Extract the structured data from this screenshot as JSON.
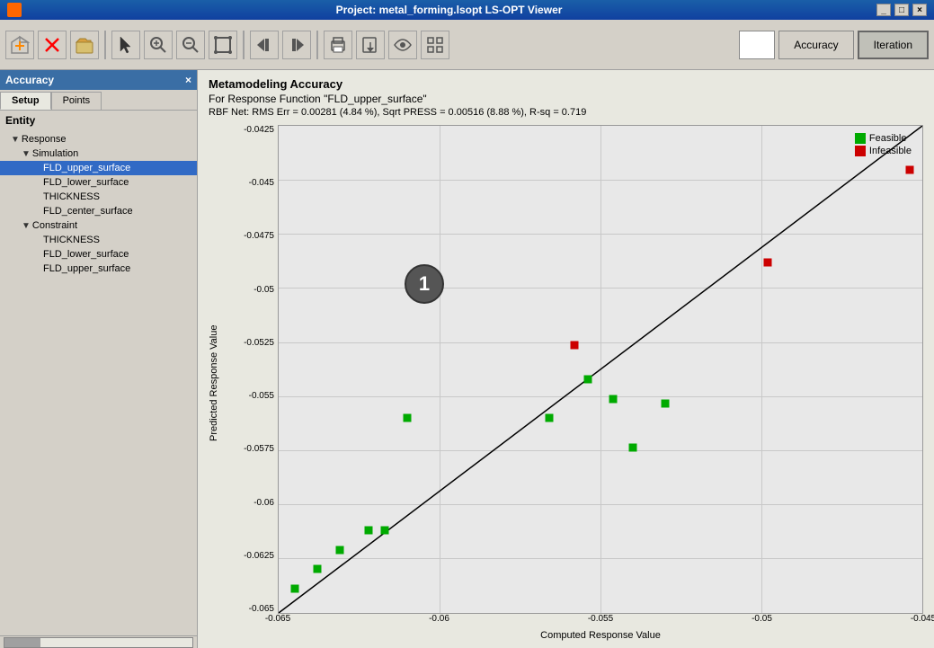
{
  "titlebar": {
    "icon": "app-icon",
    "title": "Project: metal_forming.lsopt    LS-OPT Viewer",
    "minimize_label": "_",
    "maximize_label": "□",
    "close_label": "×"
  },
  "toolbar": {
    "buttons": [
      {
        "name": "new-button",
        "icon": "⊕",
        "label": "New"
      },
      {
        "name": "open-button",
        "icon": "✗",
        "label": "Delete"
      },
      {
        "name": "save-button",
        "icon": "📁",
        "label": "Open"
      },
      {
        "name": "cursor-button",
        "icon": "↖",
        "label": "Cursor"
      },
      {
        "name": "zoom-in-button",
        "icon": "⊕",
        "label": "Zoom In"
      },
      {
        "name": "zoom-out-button",
        "icon": "⊖",
        "label": "Zoom Out"
      },
      {
        "name": "zoom-rect-button",
        "icon": "⊡",
        "label": "Zoom Rect"
      },
      {
        "name": "prev-button",
        "icon": "◀◀",
        "label": "Previous"
      },
      {
        "name": "next-button",
        "icon": "▶▶",
        "label": "Next"
      },
      {
        "name": "print-button",
        "icon": "🖨",
        "label": "Print"
      },
      {
        "name": "export-button",
        "icon": "💾",
        "label": "Export"
      },
      {
        "name": "view-button",
        "icon": "👁",
        "label": "View"
      },
      {
        "name": "grid-button",
        "icon": "⊞",
        "label": "Grid"
      }
    ],
    "accuracy_label": "Accuracy",
    "iteration_label": "Iteration"
  },
  "left_panel": {
    "title": "Accuracy",
    "close_label": "×",
    "tabs": [
      {
        "id": "setup",
        "label": "Setup",
        "active": true
      },
      {
        "id": "points",
        "label": "Points",
        "active": false
      }
    ],
    "entity_label": "Entity",
    "tree": [
      {
        "id": "response",
        "label": "Response",
        "level": 1,
        "expanded": true,
        "arrow": "▼"
      },
      {
        "id": "simulation",
        "label": "Simulation",
        "level": 2,
        "expanded": true,
        "arrow": "▼"
      },
      {
        "id": "fld_upper_surface",
        "label": "FLD_upper_surface",
        "level": 3,
        "selected": true
      },
      {
        "id": "fld_lower_surface",
        "label": "FLD_lower_surface",
        "level": 3
      },
      {
        "id": "thickness",
        "label": "THICKNESS",
        "level": 3
      },
      {
        "id": "fld_center_surface",
        "label": "FLD_center_surface",
        "level": 3
      },
      {
        "id": "constraint",
        "label": "Constraint",
        "level": 2,
        "expanded": true,
        "arrow": "▼"
      },
      {
        "id": "thickness_c",
        "label": "THICKNESS",
        "level": 3
      },
      {
        "id": "fld_lower_surface_c",
        "label": "FLD_lower_surface",
        "level": 3
      },
      {
        "id": "fld_upper_surface_c",
        "label": "FLD_upper_surface",
        "level": 3
      }
    ]
  },
  "chart": {
    "title": "Metamodeling Accuracy",
    "subtitle": "For Response Function \"FLD_upper_surface\"",
    "stats": "RBF Net: RMS Err = 0.00281 (4.84  %),  Sqrt PRESS = 0.00516 (8.88  %),  R-sq = 0.719",
    "y_axis_label": "Predicted Response Value",
    "x_axis_label": "Computed Response Value",
    "y_ticks": [
      "-0.0425",
      "-0.045",
      "-0.0475",
      "-0.05",
      "-0.0525",
      "-0.055",
      "-0.0575",
      "-0.06",
      "-0.0625",
      "-0.065"
    ],
    "x_ticks": [
      "-0.065",
      "-0.06",
      "-0.055",
      "-0.05",
      "-0.045"
    ],
    "legend": {
      "feasible_label": "Feasible",
      "infeasible_label": "Infeasible",
      "feasible_color": "#00aa00",
      "infeasible_color": "#cc0000"
    },
    "data_points": [
      {
        "x_pct": 2.5,
        "y_pct": 95,
        "type": "feasible"
      },
      {
        "x_pct": 6.0,
        "y_pct": 91,
        "type": "feasible"
      },
      {
        "x_pct": 9.5,
        "y_pct": 87,
        "type": "feasible"
      },
      {
        "x_pct": 14.0,
        "y_pct": 83,
        "type": "feasible"
      },
      {
        "x_pct": 16.5,
        "y_pct": 83,
        "type": "feasible"
      },
      {
        "x_pct": 20.0,
        "y_pct": 60,
        "type": "feasible"
      },
      {
        "x_pct": 42.0,
        "y_pct": 60,
        "type": "feasible"
      },
      {
        "x_pct": 48.0,
        "y_pct": 52,
        "type": "feasible"
      },
      {
        "x_pct": 52.0,
        "y_pct": 56,
        "type": "feasible"
      },
      {
        "x_pct": 60.0,
        "y_pct": 57,
        "type": "feasible"
      },
      {
        "x_pct": 55.0,
        "y_pct": 66,
        "type": "feasible"
      },
      {
        "x_pct": 46.0,
        "y_pct": 45,
        "type": "infeasible"
      },
      {
        "x_pct": 76.0,
        "y_pct": 28,
        "type": "infeasible"
      },
      {
        "x_pct": 98.0,
        "y_pct": 9,
        "type": "infeasible"
      }
    ],
    "annotation_number": "1"
  }
}
